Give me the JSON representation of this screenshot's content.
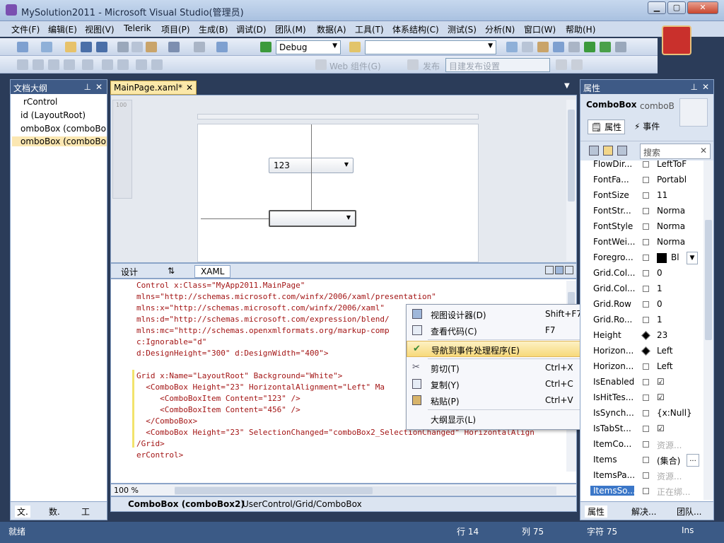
{
  "window": {
    "title": "MySolution2011 - Microsoft Visual Studio(管理员)",
    "min": "▁",
    "max": "▢",
    "close": "✕"
  },
  "menu": [
    "文件(F)",
    "编辑(E)",
    "视图(V)",
    "Telerik",
    "项目(P)",
    "生成(B)",
    "调试(D)",
    "团队(M)",
    "数据(A)",
    "工具(T)",
    "体系结构(C)",
    "测试(S)",
    "分析(N)",
    "窗口(W)",
    "帮助(H)"
  ],
  "toolbar": {
    "config": "Debug",
    "designer_label": "Web 组件(G)",
    "apply_label": "发布",
    "deploy_placeholder": "目建发布设置"
  },
  "outline": {
    "title": "文档大纲",
    "items": [
      "rControl",
      "id (LayoutRoot)",
      "omboBox (comboBo",
      "omboBox (comboBo"
    ],
    "tabs": [
      "文.",
      "数.",
      "工"
    ]
  },
  "editor": {
    "tab": "MainPage.xaml*",
    "combo_value": "123",
    "ruler": "100",
    "view_tabs": {
      "design": "设计",
      "swap": "⇅",
      "xaml": "XAML"
    },
    "code_lines": [
      "Control x:Class=\"MyApp2011.MainPage\"",
      "mlns=\"http://schemas.microsoft.com/winfx/2006/xaml/presentation\"",
      "mlns:x=\"http://schemas.microsoft.com/winfx/2006/xaml\"",
      "mlns:d=\"http://schemas.microsoft.com/expression/blend/",
      "mlns:mc=\"http://schemas.openxmlformats.org/markup-comp",
      "c:Ignorable=\"d\"",
      "d:DesignHeight=\"300\" d:DesignWidth=\"400\">",
      "",
      "Grid x:Name=\"LayoutRoot\" Background=\"White\">",
      "  <ComboBox Height=\"23\" HorizontalAlignment=\"Left\" Ma",
      "     <ComboBoxItem Content=\"123\" />",
      "     <ComboBoxItem Content=\"456\" />",
      "  </ComboBox>",
      "  <ComboBox Height=\"23\" SelectionChanged=\"comboBox2_SelectionChanged\" HorizontalAlign",
      "/Grid>",
      "erControl>"
    ],
    "zoom": "100 %",
    "breadcrumb": {
      "element": "ComboBox (comboBox2)",
      "path": "UserControl/Grid/ComboBox"
    }
  },
  "context_menu": [
    {
      "label": "视图设计器(D)",
      "shortcut": "Shift+F7",
      "icon": "designer-icon"
    },
    {
      "label": "查看代码(C)",
      "shortcut": "F7",
      "icon": "code-icon"
    },
    {
      "label": "导航到事件处理程序(E)",
      "shortcut": "",
      "icon": "navigate-icon",
      "highlighted": true
    },
    {
      "label": "剪切(T)",
      "shortcut": "Ctrl+X",
      "icon": "cut-icon"
    },
    {
      "label": "复制(Y)",
      "shortcut": "Ctrl+C",
      "icon": "copy-icon"
    },
    {
      "label": "粘贴(P)",
      "shortcut": "Ctrl+V",
      "icon": "paste-icon"
    },
    {
      "label": "大纲显示(L)",
      "shortcut": "",
      "icon": "",
      "submenu": true
    }
  ],
  "properties": {
    "title": "属性",
    "element_type": "ComboBox",
    "element_name": "comboB",
    "tab_props": "属性",
    "tab_events": "事件",
    "search_placeholder": "搜索",
    "rows": [
      {
        "name": "FlowDir...",
        "val": "LeftToF"
      },
      {
        "name": "FontFa...",
        "val": "Portabl"
      },
      {
        "name": "FontSize",
        "val": "11"
      },
      {
        "name": "FontStr...",
        "val": "Norma"
      },
      {
        "name": "FontStyle",
        "val": "Norma"
      },
      {
        "name": "FontWei...",
        "val": "Norma"
      },
      {
        "name": "Foregro...",
        "val": "Bl"
      },
      {
        "name": "Grid.Col...",
        "val": "0"
      },
      {
        "name": "Grid.Col...",
        "val": "1"
      },
      {
        "name": "Grid.Row",
        "val": "0"
      },
      {
        "name": "Grid.Ro...",
        "val": "1"
      },
      {
        "name": "Height",
        "val": "23"
      },
      {
        "name": "Horizon...",
        "val": "Left"
      },
      {
        "name": "Horizon...",
        "val": "Left"
      },
      {
        "name": "IsEnabled",
        "val": "☑"
      },
      {
        "name": "IsHitTes...",
        "val": "☑"
      },
      {
        "name": "IsSynch...",
        "val": "{x:Null}"
      },
      {
        "name": "IsTabSt...",
        "val": "☑"
      },
      {
        "name": "ItemCo...",
        "val": "资源..."
      },
      {
        "name": "Items",
        "val": "(集合)"
      },
      {
        "name": "ItemsPa...",
        "val": "资源..."
      },
      {
        "name": "ItemsSo...",
        "val": "正在绑..."
      }
    ],
    "bottom_tabs": [
      "属性",
      "解决...",
      "团队..."
    ]
  },
  "status": {
    "ready": "就绪",
    "line": "行 14",
    "col": "列 75",
    "char": "字符 75",
    "mode": "Ins"
  }
}
